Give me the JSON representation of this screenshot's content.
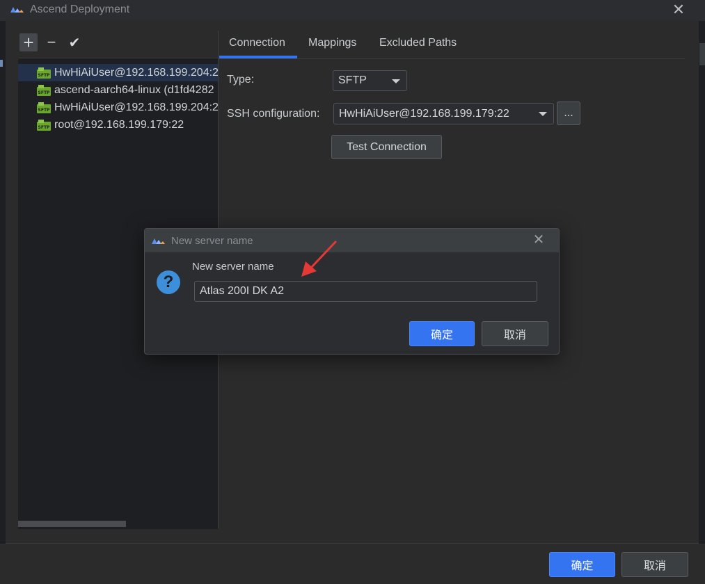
{
  "window": {
    "title": "Ascend Deployment",
    "close_glyph": "✕"
  },
  "toolbar": {
    "add_glyph": "+",
    "remove_glyph": "−",
    "apply_glyph": "✔"
  },
  "servers": [
    {
      "label": "HwHiAiUser@192.168.199.204:2",
      "icon": "sftp-icon",
      "selected": true
    },
    {
      "label": "ascend-aarch64-linux (d1fd4282",
      "icon": "sftp-icon",
      "selected": false
    },
    {
      "label": "HwHiAiUser@192.168.199.204:2",
      "icon": "sftp-icon",
      "selected": false
    },
    {
      "label": "root@192.168.199.179:22",
      "icon": "sftp-icon",
      "selected": false
    }
  ],
  "tabs": [
    {
      "label": "Connection",
      "active": true
    },
    {
      "label": "Mappings",
      "active": false
    },
    {
      "label": "Excluded Paths",
      "active": false
    }
  ],
  "connection": {
    "type_label": "Type:",
    "type_value": "SFTP",
    "ssh_label": "SSH configuration:",
    "ssh_value": "HwHiAiUser@192.168.199.179:22",
    "browse_label": "...",
    "test_button": "Test Connection"
  },
  "dialog": {
    "title": "New server name",
    "prompt": "New server name",
    "input_value": "Atlas 200I DK A2",
    "ok_label": "确定",
    "cancel_label": "取消",
    "close_glyph": "✕",
    "question_glyph": "?"
  },
  "footer": {
    "ok_label": "确定",
    "cancel_label": "取消"
  },
  "colors": {
    "accent": "#3574f0",
    "annotation_arrow": "#e53935",
    "sftp_green": "#6aa82a"
  }
}
